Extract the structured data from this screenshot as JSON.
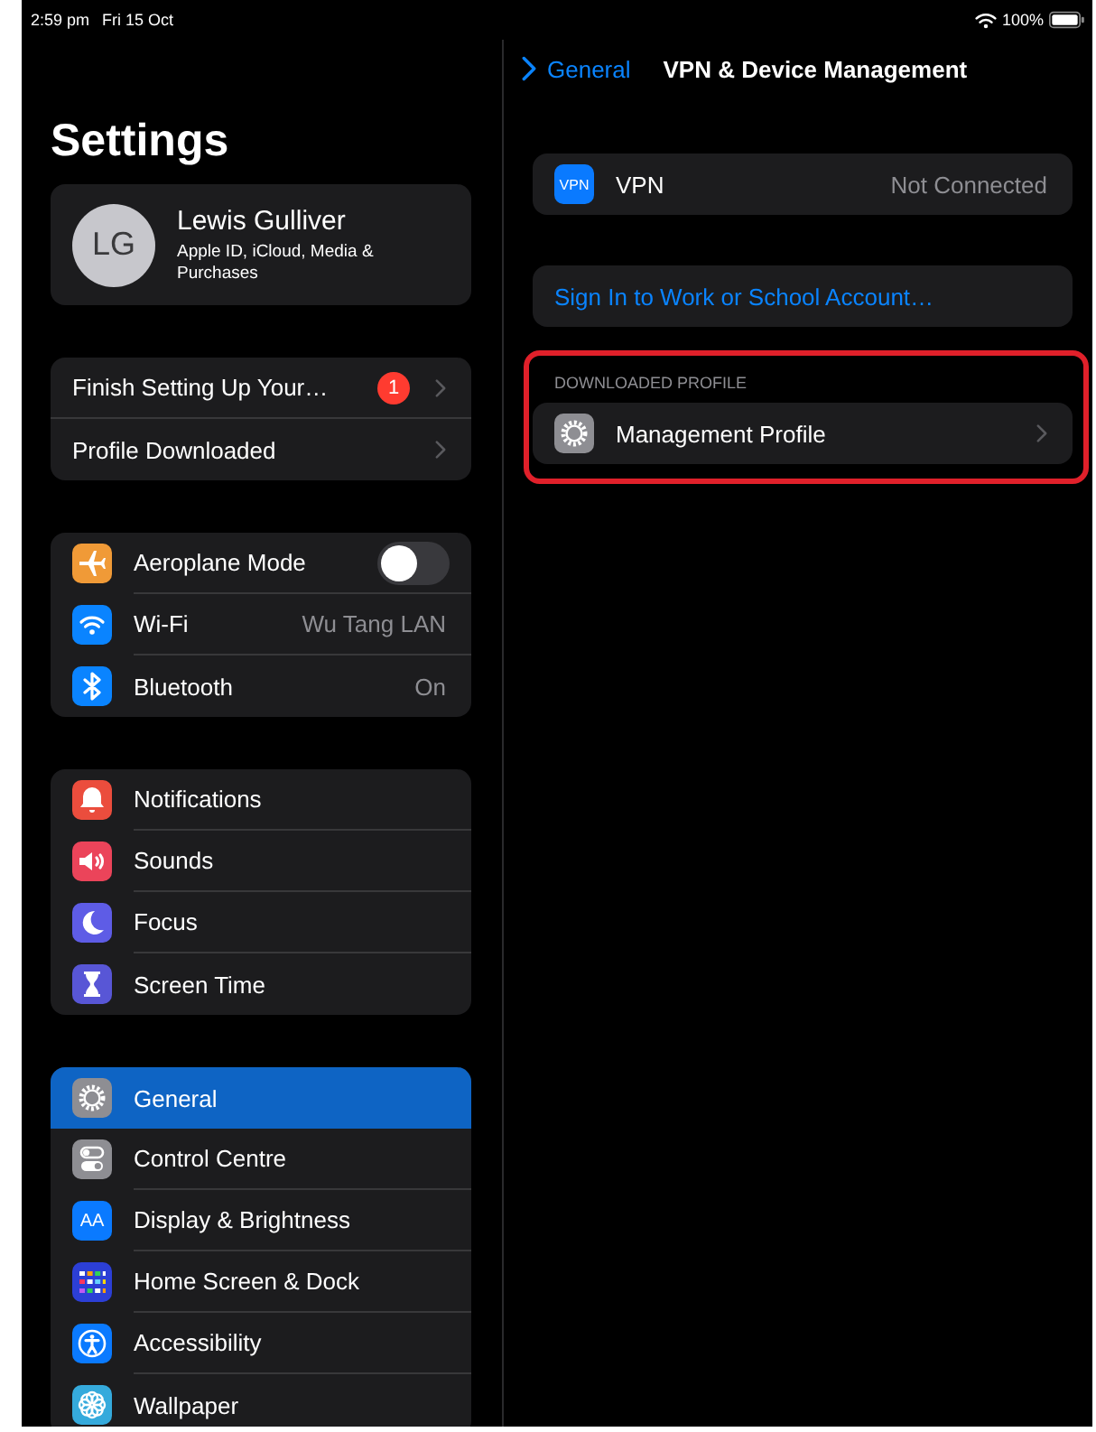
{
  "status_bar": {
    "time": "2:59 pm",
    "date": "Fri 15 Oct",
    "battery": "100%"
  },
  "sidebar": {
    "title": "Settings",
    "account": {
      "initials": "LG",
      "name": "Lewis Gulliver",
      "subtitle": "Apple ID, iCloud, Media & Purchases"
    },
    "groups": [
      {
        "items": [
          {
            "kind": "notice",
            "label": "Finish Setting Up Your…",
            "badge": "1",
            "selected": false
          },
          {
            "kind": "notice",
            "label": "Profile Downloaded",
            "selected": false
          }
        ]
      },
      {
        "items": [
          {
            "kind": "toggle",
            "label": "Aeroplane Mode",
            "on": false,
            "color": "#f09a37",
            "selected": false
          },
          {
            "kind": "value",
            "label": "Wi-Fi",
            "value": "Wu Tang LAN",
            "color": "#0a84ff",
            "selected": false
          },
          {
            "kind": "value",
            "label": "Bluetooth",
            "value": "On",
            "color": "#0a84ff",
            "selected": false
          }
        ]
      },
      {
        "items": [
          {
            "kind": "plain",
            "label": "Notifications",
            "color": "#eb4d3d",
            "selected": false
          },
          {
            "kind": "plain",
            "label": "Sounds",
            "color": "#eb445a",
            "selected": false
          },
          {
            "kind": "plain",
            "label": "Focus",
            "color": "#5e5ce6",
            "selected": false
          },
          {
            "kind": "plain",
            "label": "Screen Time",
            "color": "#5856d6",
            "selected": false
          }
        ]
      },
      {
        "items": [
          {
            "kind": "plain",
            "label": "General",
            "color": "#8e8e93",
            "selected": true
          },
          {
            "kind": "plain",
            "label": "Control Centre",
            "color": "#8e8e93",
            "selected": false
          },
          {
            "kind": "plain",
            "label": "Display & Brightness",
            "color": "#0a7aff",
            "icon_text": "AA",
            "selected": false
          },
          {
            "kind": "plain",
            "label": "Home Screen & Dock",
            "color": "#2c3fd6",
            "selected": false
          },
          {
            "kind": "plain",
            "label": "Accessibility",
            "color": "#0a7aff",
            "selected": false
          },
          {
            "kind": "plain",
            "label": "Wallpaper",
            "color": "#35aadc",
            "selected": false
          }
        ]
      }
    ]
  },
  "detail": {
    "back": "General",
    "title": "VPN & Device Management",
    "vpn": {
      "icon_text": "VPN",
      "label": "VPN",
      "value": "Not Connected"
    },
    "sign_in": "Sign In to Work or School Account…",
    "profiles": {
      "header": "DOWNLOADED PROFILE",
      "highlighted": true,
      "items": [
        {
          "label": "Management Profile"
        }
      ]
    }
  }
}
